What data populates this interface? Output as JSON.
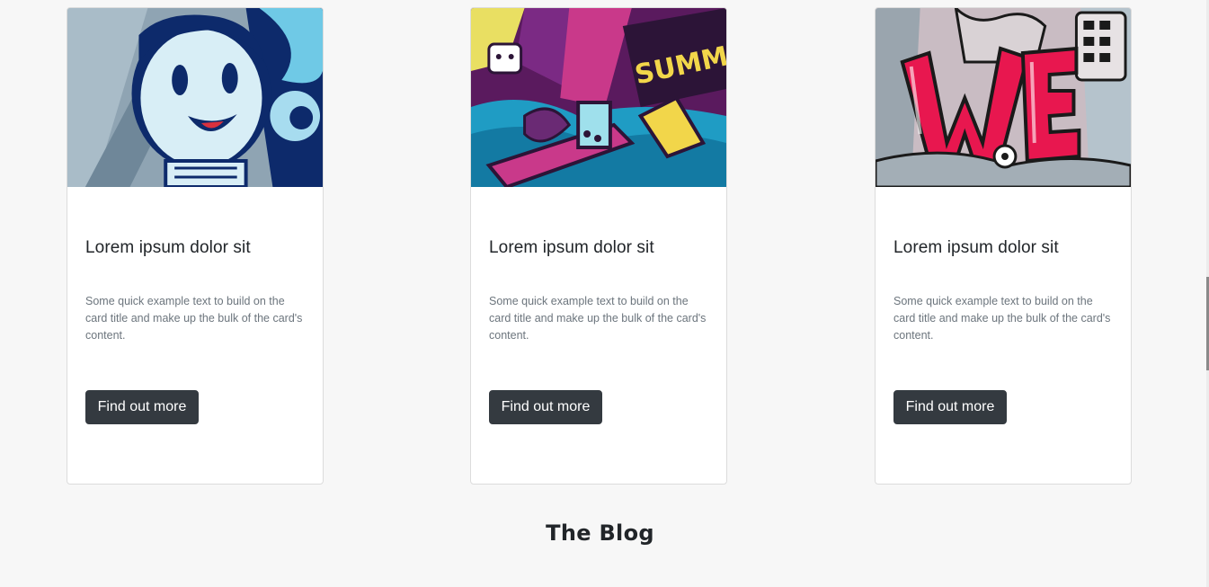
{
  "cards": [
    {
      "title": "Lorem ipsum dolor sit",
      "text": "Some quick example text to build on the card title and make up the bulk of the card's content.",
      "button_label": "Find out more",
      "image_icon": "cartoon-character-illustration"
    },
    {
      "title": "Lorem ipsum dolor sit",
      "text": "Some quick example text to build on the card title and make up the bulk of the card's content.",
      "button_label": "Find out more",
      "image_icon": "summer-doodle-illustration"
    },
    {
      "title": "Lorem ipsum dolor sit",
      "text": "Some quick example text to build on the card title and make up the bulk of the card's content.",
      "button_label": "Find out more",
      "image_icon": "we-letters-doodle-illustration"
    }
  ],
  "blog": {
    "title": "The Blog"
  },
  "colors": {
    "background": "#f7f7f7",
    "button": "#343a40",
    "title_text": "#212529",
    "body_text": "#6c757d"
  }
}
